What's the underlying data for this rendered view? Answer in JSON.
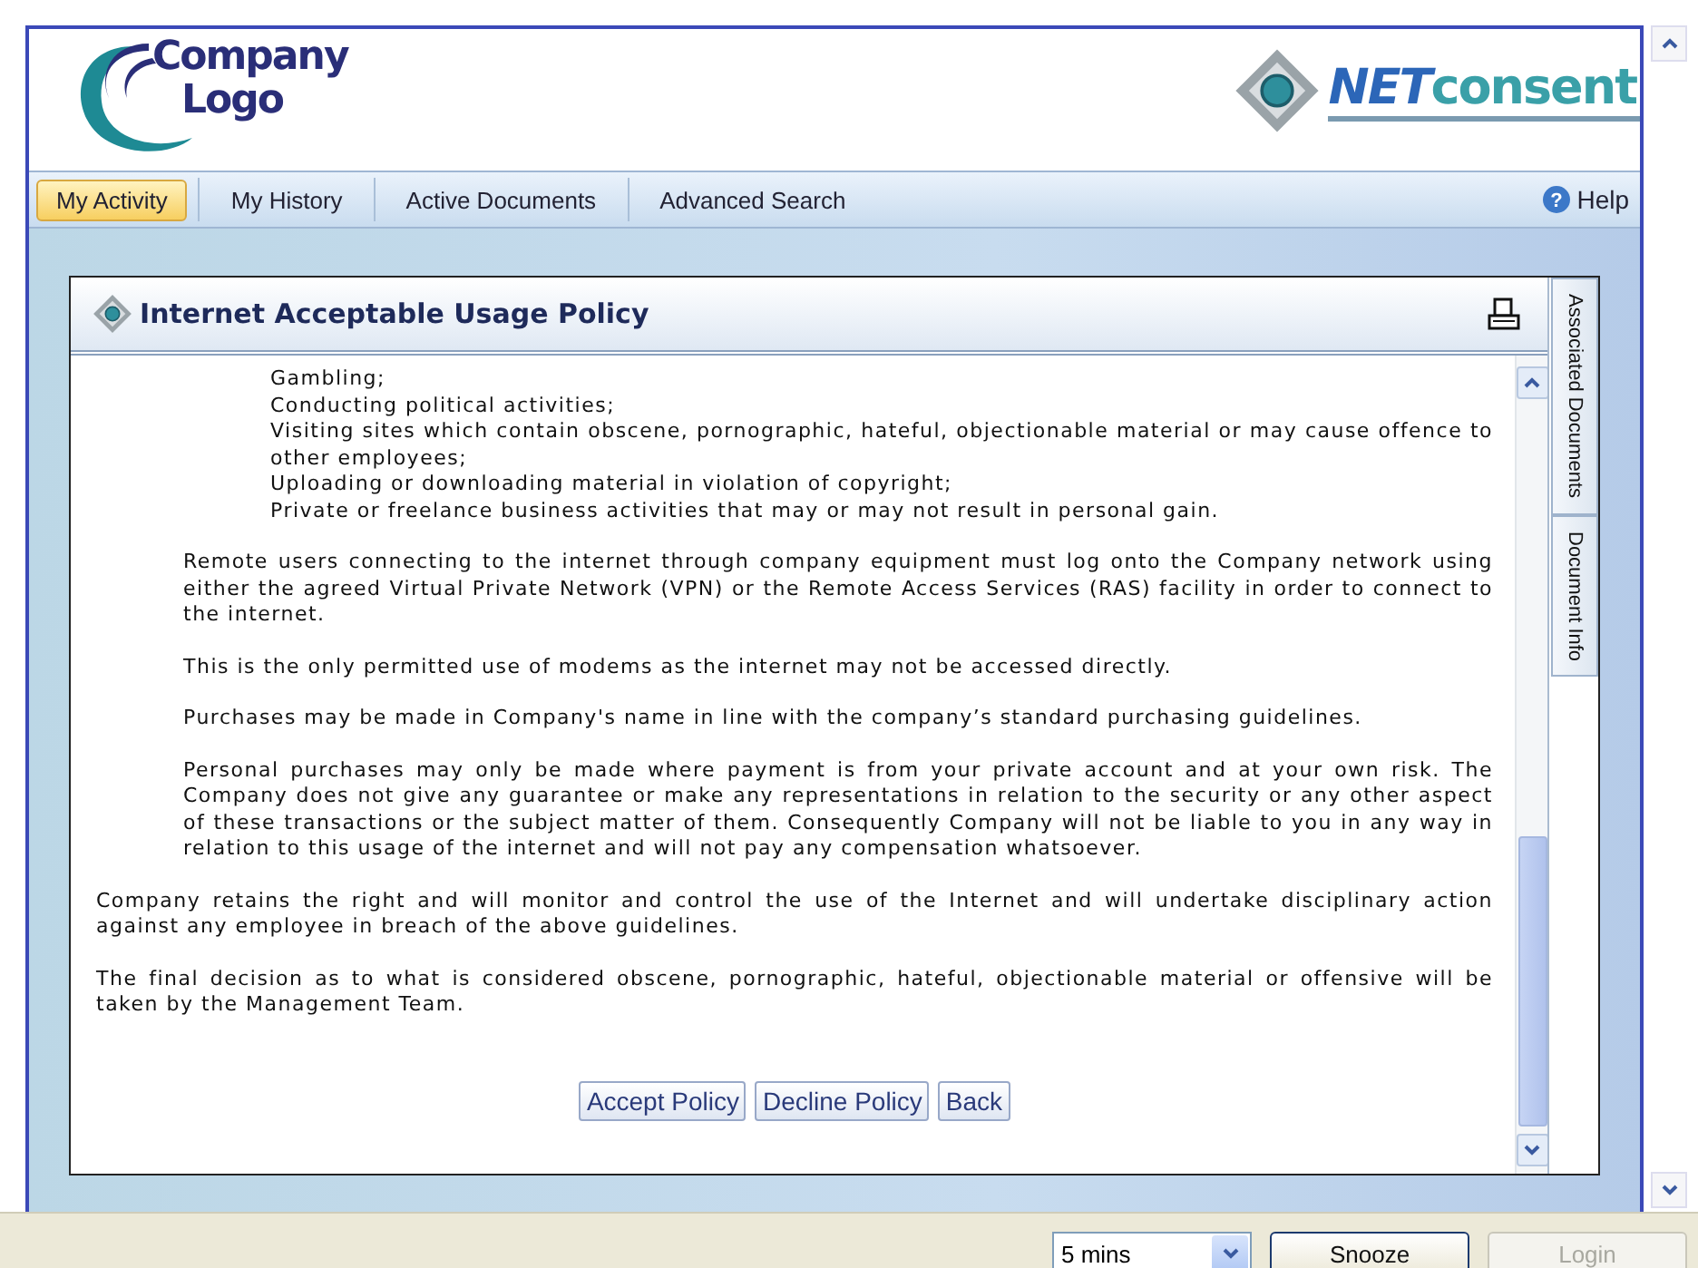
{
  "header": {
    "company_logo": {
      "line1": "Company",
      "line2": "Logo"
    },
    "product_logo": {
      "part1": "NET",
      "part2": "consent"
    }
  },
  "nav": {
    "tabs": [
      {
        "label": "My Activity",
        "selected": true
      },
      {
        "label": "My History",
        "selected": false
      },
      {
        "label": "Active Documents",
        "selected": false
      },
      {
        "label": "Advanced Search",
        "selected": false
      }
    ],
    "help": "Help",
    "help_icon": "?"
  },
  "document": {
    "title": "Internet Acceptable Usage Policy",
    "list_items": [
      "Gambling;",
      "Conducting political activities;",
      "Visiting sites which contain obscene, pornographic, hateful, objectionable material or may cause offence to other employees;",
      "Uploading or downloading material in violation of copyright;",
      "Private or freelance business activities that may or may not result in personal gain."
    ],
    "paragraphs": [
      {
        "kind": "indented",
        "text": "Remote users connecting to the internet through company equipment must log onto the Company network using either the agreed Virtual Private Network (VPN) or the Remote Access Services (RAS) facility in order to connect to the internet."
      },
      {
        "kind": "indented",
        "text": "This is the only permitted use of modems as the internet may not be accessed directly."
      },
      {
        "kind": "indented",
        "text": "Purchases may be made in Company's name in line with the company’s standard purchasing guidelines."
      },
      {
        "kind": "indented",
        "text": "Personal purchases may only be made where payment is from your private account and at your own risk. The Company does not give any guarantee or make any representations in relation to the security or any other aspect of these transactions or the subject matter of them. Consequently Company will not be liable to you in any way in relation to this usage of the internet and will not pay any compensation whatsoever."
      },
      {
        "kind": "plain",
        "text": "Company retains the right and will monitor and control the use of the Internet and will undertake disciplinary action against any employee in breach of the above guidelines."
      },
      {
        "kind": "plain",
        "text": "The final decision as to what is considered obscene, pornographic, hateful, objectionable material or offensive will be taken by the Management Team."
      }
    ],
    "buttons": [
      "Accept Policy",
      "Decline Policy",
      "Back"
    ],
    "side_tabs": [
      "Associated Documents",
      "Document Info"
    ]
  },
  "footer": {
    "snooze_select": {
      "value": "5 mins"
    },
    "buttons": [
      {
        "label": "Snooze",
        "disabled": false
      },
      {
        "label": "Login",
        "disabled": true
      }
    ]
  }
}
